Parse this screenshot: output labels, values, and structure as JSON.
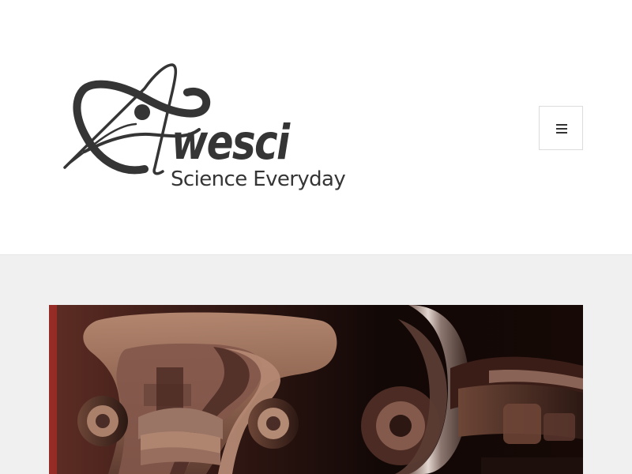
{
  "site": {
    "logo_text": "wesci",
    "tagline": "Science Everyday"
  },
  "header": {
    "menu_button": {
      "icon": "hamburger-menu-icon"
    }
  },
  "featured_image": {
    "subject": "railway-bogie"
  },
  "colors": {
    "logo": "#353535",
    "header_background": "#ffffff",
    "page_background": "#f0f0f0",
    "button_border": "#dcdcdc",
    "image_tint": "#8a6150"
  }
}
